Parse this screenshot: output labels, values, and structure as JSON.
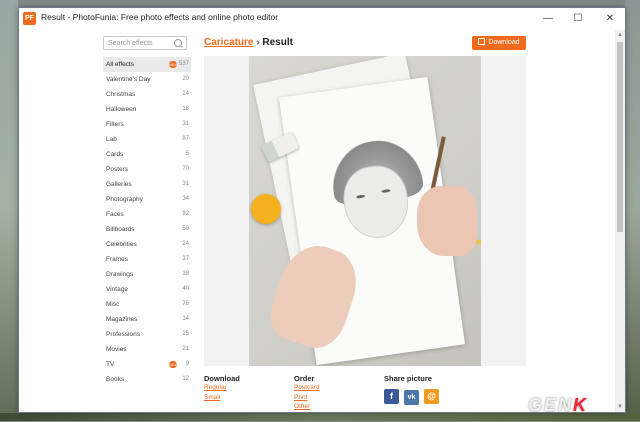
{
  "window": {
    "title": "Result - PhotoFunia: Free photo effects and online photo editor",
    "icon_text": "PF",
    "minimize": "—",
    "maximize": "☐",
    "close": "✕"
  },
  "search": {
    "placeholder": "Search effects"
  },
  "categories": [
    {
      "label": "All effects",
      "count": "537",
      "new": true,
      "active": true
    },
    {
      "label": "Valentine's Day",
      "count": "20"
    },
    {
      "label": "Christmas",
      "count": "24"
    },
    {
      "label": "Halloween",
      "count": "16"
    },
    {
      "label": "Filters",
      "count": "31"
    },
    {
      "label": "Lab",
      "count": "87"
    },
    {
      "label": "Cards",
      "count": "5"
    },
    {
      "label": "Posters",
      "count": "70"
    },
    {
      "label": "Galleries",
      "count": "31"
    },
    {
      "label": "Photography",
      "count": "34"
    },
    {
      "label": "Faces",
      "count": "92"
    },
    {
      "label": "Billboards",
      "count": "50"
    },
    {
      "label": "Celebrities",
      "count": "24"
    },
    {
      "label": "Frames",
      "count": "37"
    },
    {
      "label": "Drawings",
      "count": "38"
    },
    {
      "label": "Vintage",
      "count": "40"
    },
    {
      "label": "Misc",
      "count": "75"
    },
    {
      "label": "Magazines",
      "count": "14"
    },
    {
      "label": "Professions",
      "count": "25"
    },
    {
      "label": "Movies",
      "count": "21"
    },
    {
      "label": "TV",
      "count": "9",
      "new": true
    },
    {
      "label": "Books",
      "count": "12"
    }
  ],
  "new_badge": "NEW",
  "breadcrumb": {
    "link": "Caricature",
    "separator": "›",
    "current": "Result"
  },
  "download_button": "Download",
  "footer": {
    "download": {
      "title": "Download",
      "links": [
        "Regular",
        "Small"
      ]
    },
    "order": {
      "title": "Order",
      "links": [
        "Postcard",
        "Print",
        "Other"
      ]
    },
    "share": {
      "title": "Share picture",
      "facebook": "f",
      "vk": "vk",
      "email": "@"
    }
  },
  "watermark": {
    "text": "GEN",
    "accent": "K"
  },
  "colors": {
    "accent": "#f26b1d",
    "facebook": "#3b5998",
    "vk": "#4a76a8",
    "email": "#f29a1d"
  }
}
